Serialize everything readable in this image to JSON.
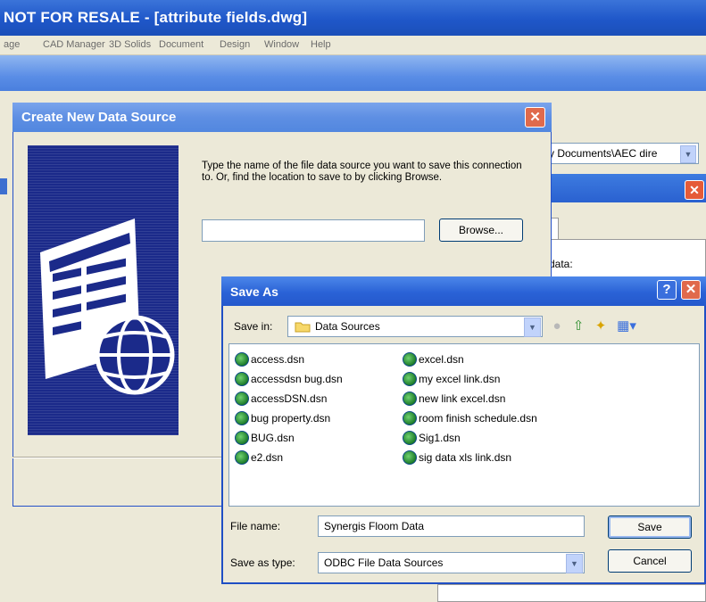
{
  "app": {
    "title": "NOT FOR RESALE - [attribute fields.dwg]",
    "menu": [
      "age",
      "CAD Manager",
      "3D Solids",
      "Document",
      "Design",
      "Window",
      "Help"
    ],
    "bg_path": "My Documents\\AEC dire",
    "bg_label": "data:"
  },
  "create_dialog": {
    "title": "Create New Data Source",
    "instructions": "Type the name of the file data source you want to save this connection to.  Or, find the location to save to by clicking Browse.",
    "input_value": "",
    "browse_label": "Browse..."
  },
  "save_as": {
    "title": "Save As",
    "save_in_label": "Save in:",
    "save_in_value": "Data Sources",
    "files_col1": [
      "access.dsn",
      "accessdsn bug.dsn",
      "accessDSN.dsn",
      "bug property.dsn",
      "BUG.dsn",
      "e2.dsn"
    ],
    "files_col2": [
      "excel.dsn",
      "my excel link.dsn",
      "new link excel.dsn",
      "room finish schedule.dsn",
      "Sig1.dsn",
      "sig data xls link.dsn"
    ],
    "file_name_label": "File name:",
    "file_name_value": "Synergis Floom Data",
    "save_type_label": "Save as type:",
    "save_type_value": "ODBC File Data Sources",
    "save_button": "Save",
    "cancel_button": "Cancel"
  },
  "icons": [
    "close-icon",
    "help-icon",
    "folder-icon",
    "back-icon",
    "up-folder-icon",
    "new-folder-icon",
    "views-icon",
    "globe-dsn-icon",
    "chevron-down-icon"
  ]
}
